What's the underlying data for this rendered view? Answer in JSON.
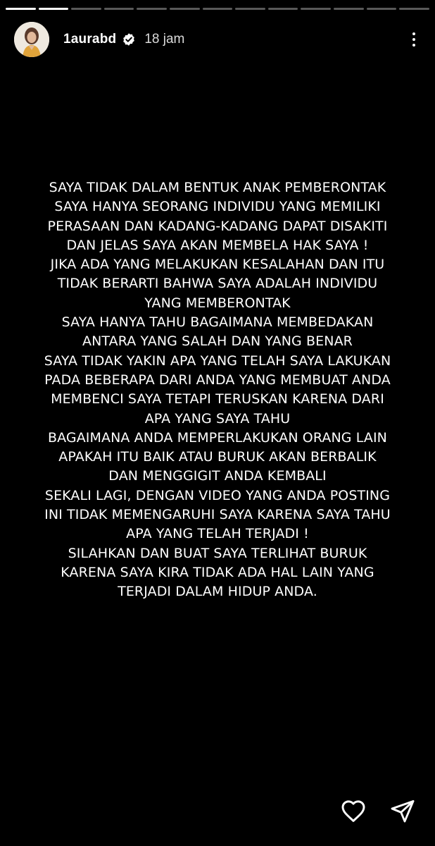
{
  "story": {
    "segments_total": 13,
    "segments_viewed": 2,
    "username": "1aurabd",
    "verified": true,
    "time_ago": "18 jam",
    "lines": [
      "SAYA TIDAK DALAM BENTUK ANAK PEMBERONTAK",
      "SAYA HANYA SEORANG INDIVIDU YANG MEMILIKI",
      "PERASAAN DAN KADANG-KADANG DAPAT DISAKITI",
      "DAN JELAS SAYA AKAN MEMBELA HAK SAYA !",
      "JIKA ADA YANG MELAKUKAN KESALAHAN DAN ITU",
      "TIDAK BERARTI BAHWA SAYA ADALAH INDIVIDU",
      "YANG MEMBERONTAK",
      "SAYA HANYA TAHU BAGAIMANA MEMBEDAKAN",
      "ANTARA YANG SALAH DAN YANG BENAR",
      "SAYA TIDAK YAKIN APA YANG TELAH SAYA LAKUKAN",
      "PADA BEBERAPA DARI ANDA YANG MEMBUAT ANDA",
      "MEMBENCI SAYA TETAPI TERUSKAN KARENA DARI",
      "APA YANG SAYA TAHU",
      "BAGAIMANA ANDA MEMPERLAKUKAN ORANG LAIN",
      "APAKAH ITU BAIK ATAU BURUK AKAN BERBALIK",
      "DAN MENGGIGIT ANDA KEMBALI",
      "SEKALI LAGI, DENGAN VIDEO YANG ANDA POSTING",
      "INI TIDAK MEMENGARUHI SAYA KARENA SAYA TAHU",
      "APA YANG TELAH TERJADI !",
      "SILAHKAN DAN BUAT SAYA TERLIHAT BURUK",
      "KARENA SAYA KIRA TIDAK ADA HAL LAIN YANG",
      "TERJADI DALAM HIDUP ANDA."
    ]
  },
  "icons": {
    "more": "more-vertical-icon",
    "like": "heart-icon",
    "share": "send-icon",
    "verified": "verified-badge-icon"
  },
  "colors": {
    "background": "#000000",
    "text": "#ffffff",
    "progress_done": "#ffffff",
    "progress_pending": "rgba(255,255,255,0.35)"
  }
}
